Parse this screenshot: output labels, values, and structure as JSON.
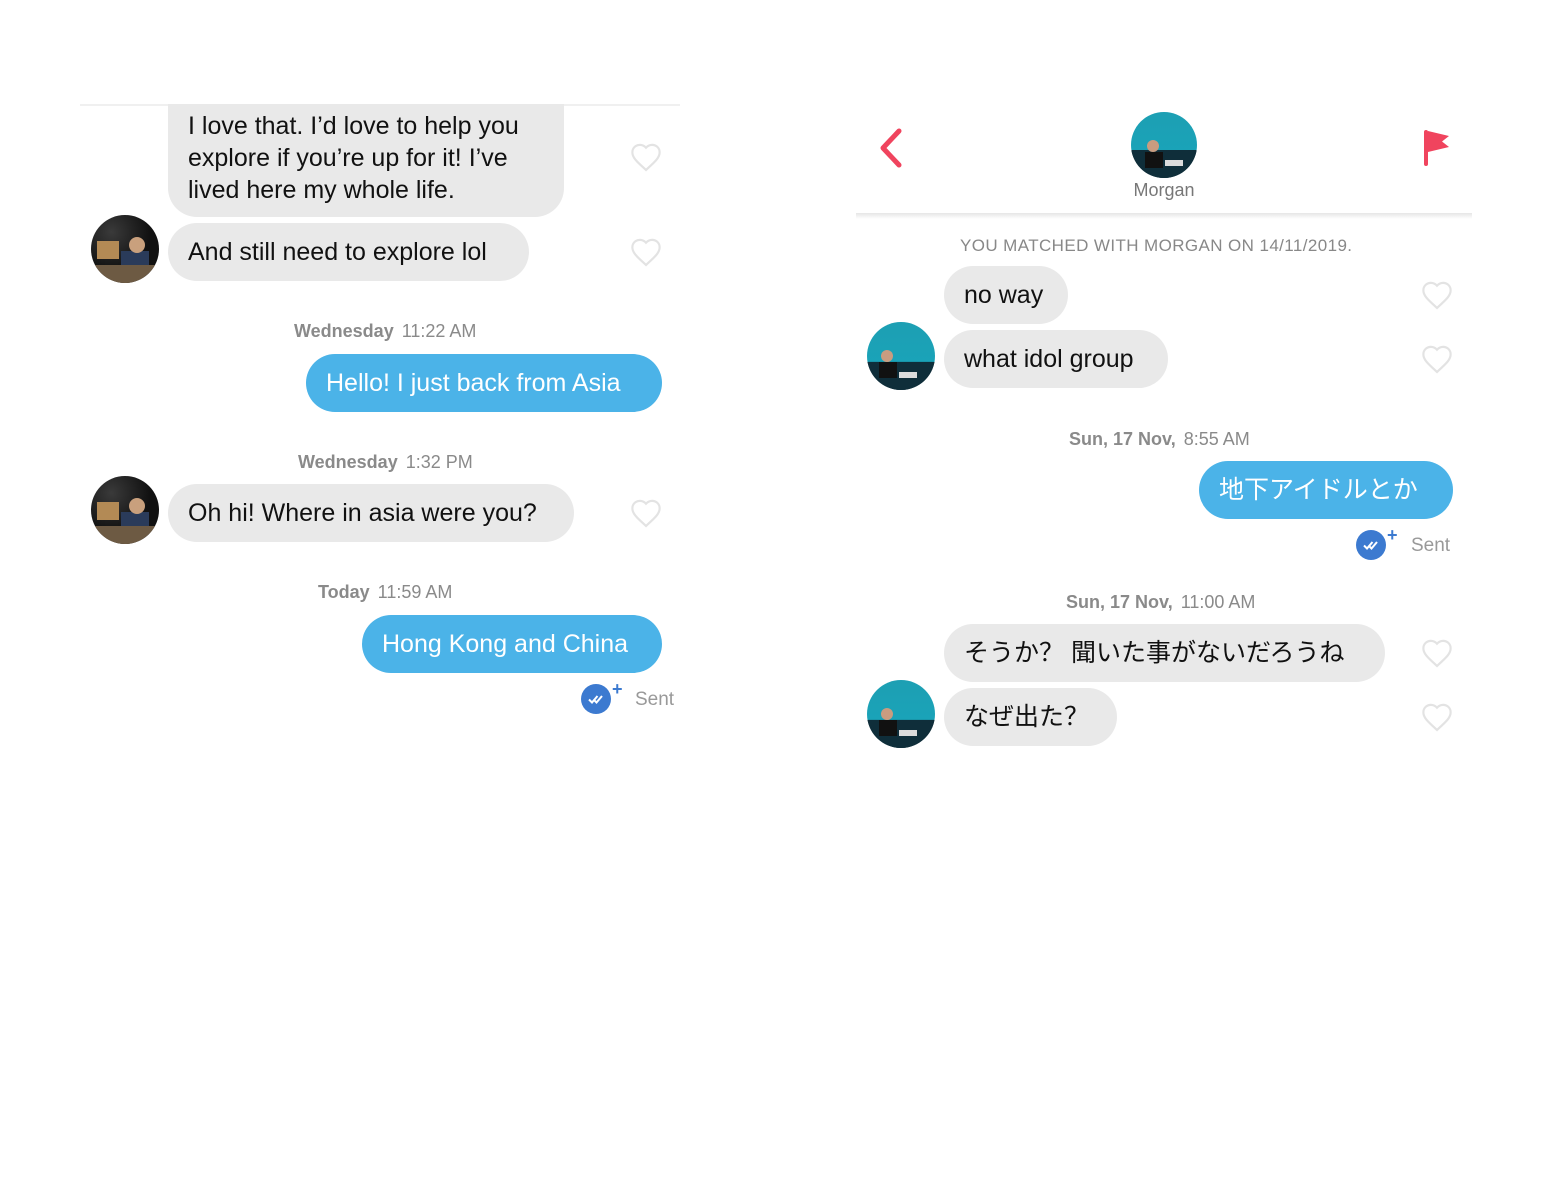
{
  "left": {
    "messages": [
      {
        "text": "I love that. I’d love to help you explore if you’re up for it! I’ve lived here my whole life."
      },
      {
        "text": "And still need to explore lol"
      },
      {
        "text": "Hello! I just back from Asia"
      },
      {
        "text": "Oh hi! Where in asia were you?"
      },
      {
        "text": "Hong Kong and China"
      }
    ],
    "timestamps": [
      {
        "day": "Wednesday",
        "time": "11:22 AM"
      },
      {
        "day": "Wednesday",
        "time": "1:32 PM"
      },
      {
        "day": "Today",
        "time": "11:59 AM"
      }
    ],
    "sent_label": "Sent"
  },
  "right": {
    "header": {
      "name": "Morgan"
    },
    "match_text": "YOU MATCHED WITH MORGAN ON 14/11/2019.",
    "messages": [
      {
        "text": "no way"
      },
      {
        "text": "what idol group"
      },
      {
        "text": "地下アイドルとか"
      },
      {
        "text": "そうか？ 聞いた事がないだろうね"
      },
      {
        "text": "なぜ出た？"
      }
    ],
    "timestamps": [
      {
        "day": "Sun, 17 Nov,",
        "time": "8:55 AM"
      },
      {
        "day": "Sun, 17 Nov,",
        "time": "11:00 AM"
      }
    ],
    "sent_label": "Sent"
  },
  "colors": {
    "accent_pink": "#f0445e",
    "bubble_blue": "#4bb3e8",
    "bubble_grey": "#e9e9e9",
    "receipt_blue": "#3c7ad0"
  },
  "icons": [
    "back-chevron-icon",
    "report-flag-icon",
    "heart-icon",
    "read-receipt-icon"
  ]
}
